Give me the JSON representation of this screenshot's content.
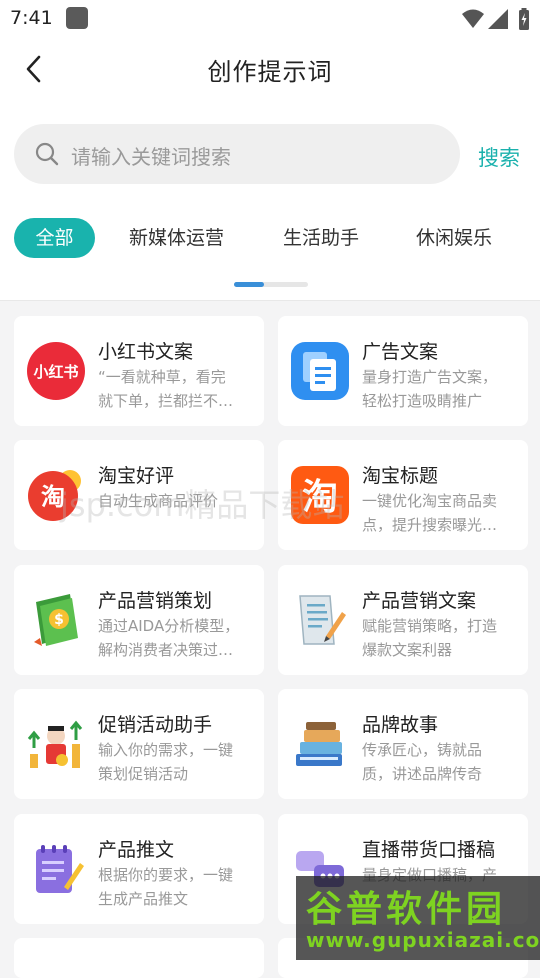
{
  "status_bar": {
    "time": "7:41"
  },
  "header": {
    "title": "创作提示词"
  },
  "search": {
    "placeholder": "请输入关键词搜索",
    "button": "搜索"
  },
  "tabs": [
    "全部",
    "新媒体运营",
    "生活助手",
    "休闲娱乐"
  ],
  "cards": [
    {
      "name": "小红书文案",
      "desc1": "“一看就种草，看完",
      "desc2": "就下单，拦都拦不…",
      "icon": "xiaohongshu-icon",
      "icon_text": "小红书"
    },
    {
      "name": "广告文案",
      "desc1": "量身打造广告文案，",
      "desc2": "轻松打造吸睛推广",
      "icon": "document-copy-icon"
    },
    {
      "name": "淘宝好评",
      "desc1": "自动生成商品评价",
      "desc2": "",
      "icon": "taobao-review-icon",
      "icon_text": "淘"
    },
    {
      "name": "淘宝标题",
      "desc1": "一键优化淘宝商品卖",
      "desc2": "点，提升搜索曝光…",
      "icon": "taobao-icon",
      "icon_text": "淘"
    },
    {
      "name": "产品营销策划",
      "desc1": "通过AIDA分析模型，",
      "desc2": "解构消费者决策过…",
      "icon": "money-book-icon"
    },
    {
      "name": "产品营销文案",
      "desc1": "赋能营销策略，打造",
      "desc2": "爆款文案利器",
      "icon": "scroll-pen-icon"
    },
    {
      "name": "促销活动助手",
      "desc1": "输入你的需求，一键",
      "desc2": "策划促销活动",
      "icon": "promotion-icon"
    },
    {
      "name": "品牌故事",
      "desc1": "传承匠心，铸就品",
      "desc2": "质，讲述品牌传奇",
      "icon": "books-icon"
    },
    {
      "name": "产品推文",
      "desc1": "根据你的要求，一键",
      "desc2": "生成产品推文",
      "icon": "notepad-icon"
    },
    {
      "name": "直播带货口播稿",
      "desc1": "量身定做口播稿，产",
      "desc2": "",
      "icon": "chat-bubbles-icon"
    }
  ],
  "watermark": {
    "text": "jsp.com精品下载站"
  },
  "brand_logo": {
    "title": "谷普软件园",
    "url": "www.gupuxiazai.com"
  },
  "colors": {
    "accent": "#19b3ad",
    "indicator": "#3a8fd8"
  }
}
